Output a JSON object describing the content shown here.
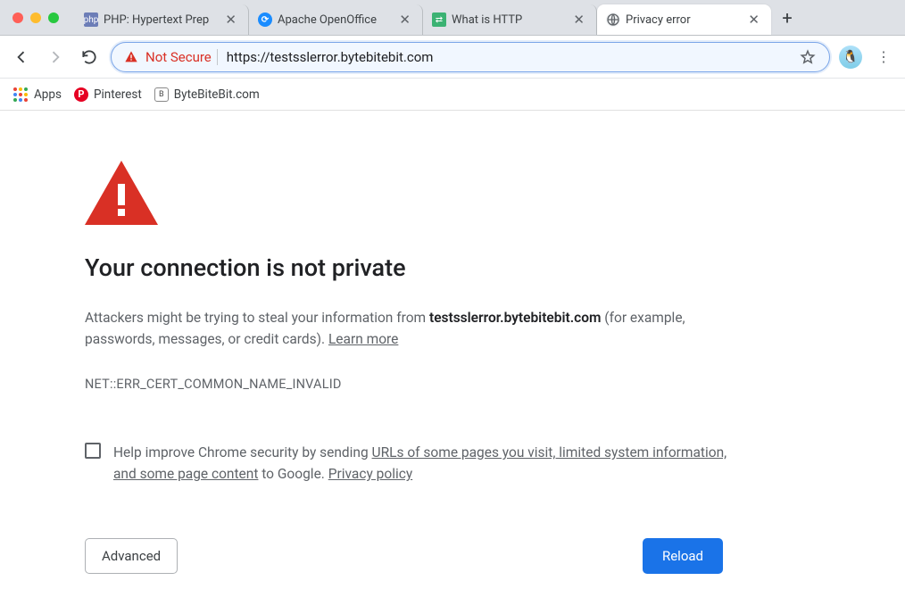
{
  "tabs": [
    {
      "title": "PHP: Hypertext Prep",
      "favicon": "php"
    },
    {
      "title": "Apache OpenOffice",
      "favicon": "ooo"
    },
    {
      "title": "What is HTTP",
      "favicon": "http"
    },
    {
      "title": "Privacy error",
      "favicon": "globe",
      "active": true
    }
  ],
  "omnibox": {
    "security_label": "Not Secure",
    "url": "https://testsslerror.bytebitebit.com"
  },
  "bookmarks": {
    "apps": "Apps",
    "pinterest": "Pinterest",
    "bbb": "ByteBiteBit.com"
  },
  "error": {
    "heading": "Your connection is not private",
    "body_prefix": "Attackers might be trying to steal your information from ",
    "host": "testsslerror.bytebitebit.com",
    "body_suffix": " (for example, passwords, messages, or credit cards). ",
    "learn_more": "Learn more",
    "code": "NET::ERR_CERT_COMMON_NAME_INVALID",
    "optin_pre": "Help improve Chrome security by sending ",
    "optin_link1": "URLs of some pages you visit, limited system information, and some page content",
    "optin_mid": " to Google. ",
    "privacy_policy": "Privacy policy",
    "advanced": "Advanced",
    "reload": "Reload"
  }
}
